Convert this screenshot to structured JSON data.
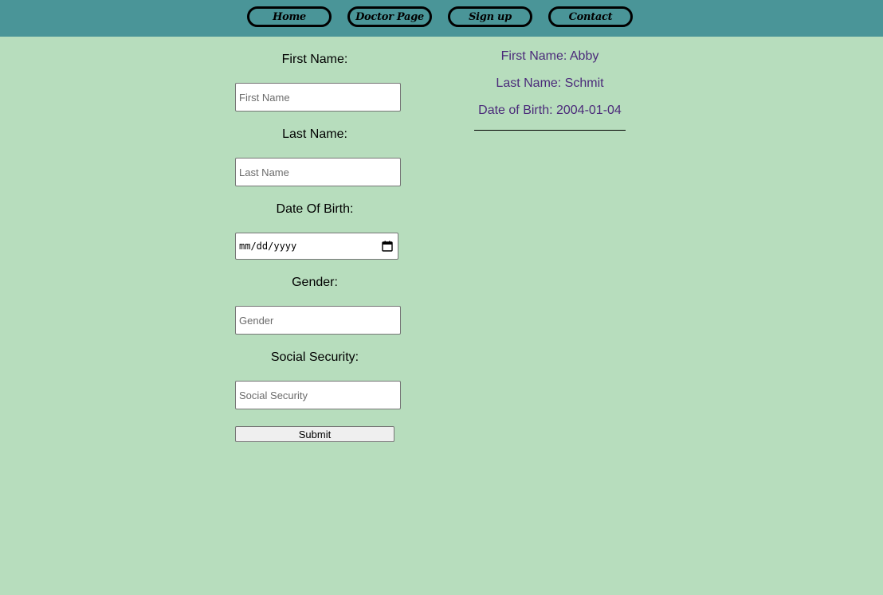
{
  "nav": {
    "items": [
      {
        "label": "Home"
      },
      {
        "label": "Doctor Page"
      },
      {
        "label": "Sign up"
      },
      {
        "label": "Contact"
      }
    ]
  },
  "form": {
    "first_name": {
      "label": "First Name:",
      "placeholder": "First Name",
      "value": ""
    },
    "last_name": {
      "label": "Last Name:",
      "placeholder": "Last Name",
      "value": ""
    },
    "dob": {
      "label": "Date Of Birth:",
      "display": "mm/dd/yyyy",
      "icon": "calendar-icon"
    },
    "gender": {
      "label": "Gender:",
      "placeholder": "Gender",
      "value": ""
    },
    "ssn": {
      "label": "Social Security:",
      "placeholder": "Social Security",
      "value": ""
    },
    "submit_label": "Submit"
  },
  "patient": {
    "first_name": "First Name: Abby",
    "last_name": "Last Name: Schmit",
    "dob": "Date of Birth: 2004-01-04"
  },
  "colors": {
    "navbar": "#4a9598",
    "background": "#b7ddbd",
    "info_text": "#4b2a7a"
  }
}
